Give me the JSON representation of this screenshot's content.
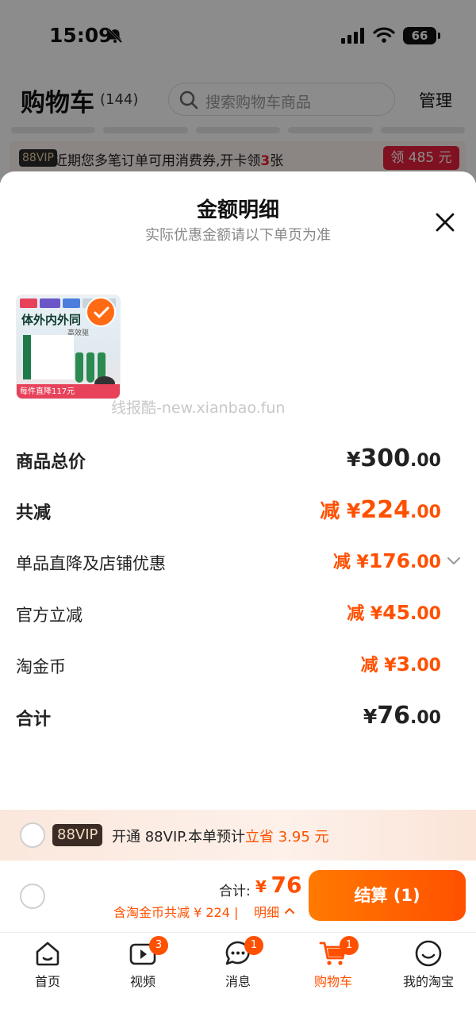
{
  "status_bar": {
    "time": "15:09",
    "battery": "66"
  },
  "header": {
    "title": "购物车",
    "count": "(144)",
    "search_placeholder": "搜索购物车商品",
    "manage": "管理"
  },
  "vip_banner": {
    "tag": "88VIP",
    "text_before": "近期您多笔订单可用消费券,开卡领",
    "highlight": "3",
    "text_after": "张",
    "claim": "领 485 元"
  },
  "sheet": {
    "title": "金额明细",
    "subtitle": "实际优惠金额请以下单页为准",
    "product": {
      "headline": "体外内外同",
      "subline": "高效驱",
      "price_tag": "每件直降117元"
    },
    "watermark": "线报酷-new.xianbao.fun",
    "rows": [
      {
        "label": "商品总价",
        "prefix": "",
        "yen": "¥",
        "int": "300",
        "dec": ".00"
      },
      {
        "label": "共减",
        "prefix": "减 ",
        "yen": "¥",
        "int": "224",
        "dec": ".00"
      },
      {
        "label": "单品直降及店铺优惠",
        "prefix": "减 ",
        "yen": "¥",
        "int": "176",
        "dec": ".00"
      },
      {
        "label": "官方立减",
        "prefix": "减 ",
        "yen": "¥",
        "int": "45",
        "dec": ".00"
      },
      {
        "label": "淘金币",
        "prefix": "减 ",
        "yen": "¥",
        "int": "3",
        "dec": ".00"
      },
      {
        "label": "合计",
        "prefix": "",
        "yen": "¥",
        "int": "76",
        "dec": ".00"
      }
    ]
  },
  "vip_strip": {
    "badge": "88VIP",
    "text": "开通 88VIP.本单预计",
    "save": "立省 3.95 元"
  },
  "checkout": {
    "total_label": "合计:",
    "yen": "¥",
    "total": "76",
    "sub": "含淘金币共减 ¥ 224 | ",
    "detail": "明细",
    "button": "结算 (1)"
  },
  "tabs": [
    {
      "label": "首页",
      "badge": ""
    },
    {
      "label": "视频",
      "badge": "3"
    },
    {
      "label": "消息",
      "badge": "1"
    },
    {
      "label": "购物车",
      "badge": "1"
    },
    {
      "label": "我的淘宝",
      "badge": ""
    }
  ],
  "colors": {
    "accent": "#ff5000",
    "vip_red": "#e8203b",
    "text": "#222222"
  }
}
